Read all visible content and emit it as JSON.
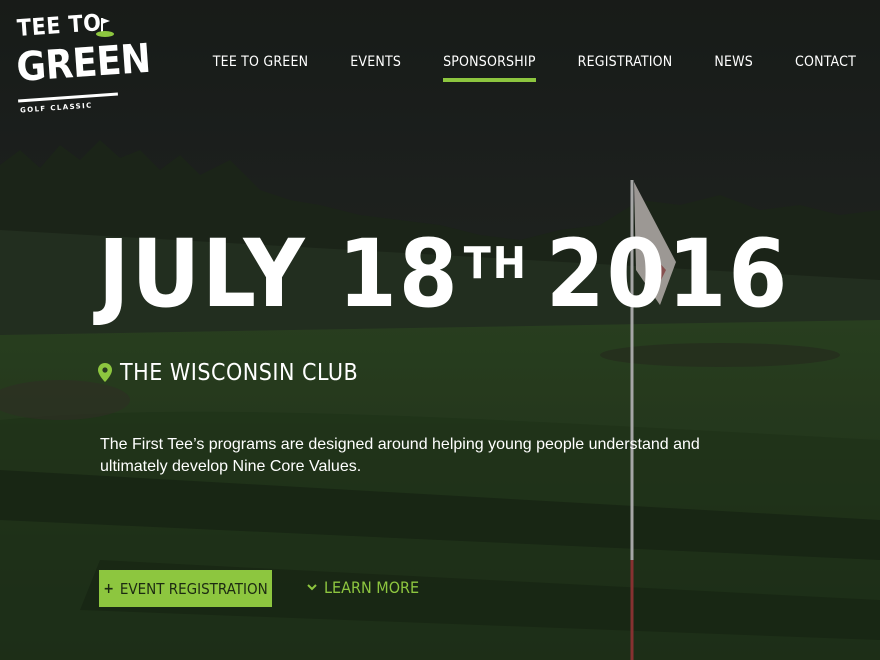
{
  "logo": {
    "line1": "TEE TO",
    "line2": "GREEN",
    "line3": "GOLF CLASSIC"
  },
  "nav": {
    "items": [
      {
        "label": "TEE TO GREEN"
      },
      {
        "label": "EVENTS"
      },
      {
        "label": "SPONSORSHIP"
      },
      {
        "label": "REGISTRATION"
      },
      {
        "label": "NEWS"
      },
      {
        "label": "CONTACT"
      }
    ],
    "active": "SPONSORSHIP"
  },
  "hero": {
    "date_main": "JULY 18",
    "date_suffix": "TH",
    "date_year": "2016",
    "venue": "THE WISCONSIN CLUB",
    "venue_icon": "map-pin-icon",
    "description": "The First Tee’s programs are designed around helping young people understand and ultimately develop Nine Core Values.",
    "primary_button": "EVENT REGISTRATION",
    "primary_button_icon": "+",
    "secondary_button": "LEARN MORE"
  },
  "colors": {
    "accent": "#8dc63f",
    "text": "#ffffff"
  }
}
